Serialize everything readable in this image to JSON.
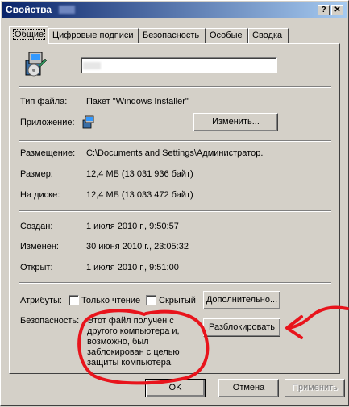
{
  "window": {
    "title": "Свойства",
    "help_glyph": "?",
    "close_glyph": "✕"
  },
  "tabs": [
    {
      "label": "Общие",
      "active": true
    },
    {
      "label": "Цифровые подписи"
    },
    {
      "label": "Безопасность"
    },
    {
      "label": "Особые"
    },
    {
      "label": "Сводка"
    }
  ],
  "general": {
    "file_type_label": "Тип файла:",
    "file_type_value": "Пакет \"Windows Installer\"",
    "app_label": "Приложение:",
    "change_button": "Изменить...",
    "location_label": "Размещение:",
    "location_value": "C:\\Documents and Settings\\Администратор.",
    "size_label": "Размер:",
    "size_value": "12,4 МБ (13 031 936 байт)",
    "disk_label": "На диске:",
    "disk_value": "12,4 МБ (13 033 472 байт)",
    "created_label": "Создан:",
    "created_value": "1 июля 2010 г., 9:50:57",
    "modified_label": "Изменен:",
    "modified_value": "30 июня 2010 г., 23:05:32",
    "opened_label": "Открыт:",
    "opened_value": "1 июля 2010 г., 9:51:00",
    "attributes_label": "Атрибуты:",
    "readonly_label": "Только чтение",
    "hidden_label": "Скрытый",
    "advanced_button": "Дополнительно...",
    "security_label": "Безопасность:",
    "security_text": "Этот файл получен с другого компьютера и, возможно, был заблокирован с целью защиты компьютера.",
    "unblock_button": "Разблокировать"
  },
  "footer": {
    "ok": "OK",
    "cancel": "Отмена",
    "apply": "Применить"
  },
  "colors": {
    "annotation_red": "#e8141c",
    "titlebar_start": "#0a246a",
    "titlebar_end": "#a6caf0"
  }
}
